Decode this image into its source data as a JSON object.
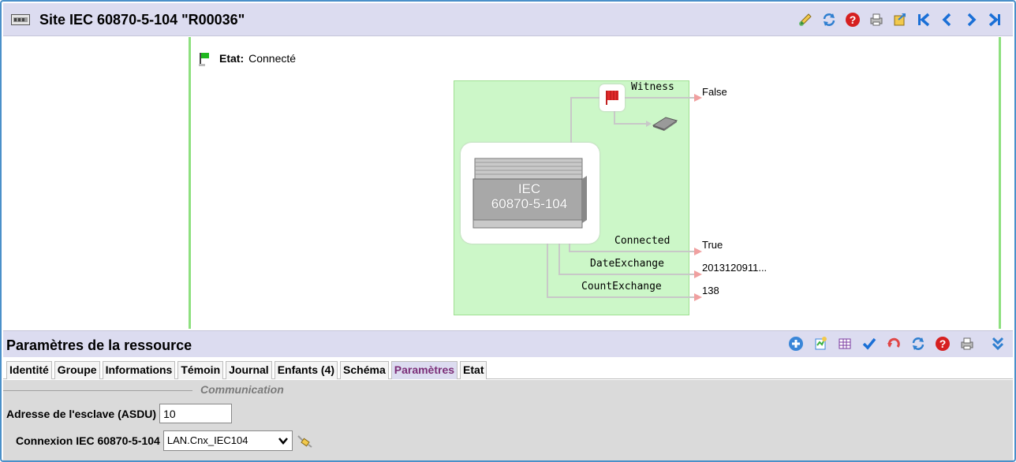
{
  "header": {
    "title": "Site IEC 60870-5-104 \"R00036\"",
    "icons": [
      "edit-icon",
      "refresh-icon",
      "help-icon",
      "print-icon",
      "export-icon",
      "first-icon",
      "previous-icon",
      "next-icon",
      "last-icon"
    ]
  },
  "diagram": {
    "etat_label": "Etat:",
    "etat_value": "Connecté",
    "device_label_line1": "IEC",
    "device_label_line2": "60870-5-104",
    "outputs": [
      {
        "name": "Witness",
        "value": "False"
      },
      {
        "name": "Connected",
        "value": "True"
      },
      {
        "name": "DateExchange",
        "value": "2013120911..."
      },
      {
        "name": "CountExchange",
        "value": "138"
      }
    ],
    "colors": {
      "state_box": "#ccf7c8",
      "rail": "#8ee07f",
      "arrow": "#f0a0a0"
    }
  },
  "params": {
    "title": "Paramètres de la ressource",
    "icons": [
      "add-icon",
      "new-icon",
      "grid-icon",
      "validate-icon",
      "undo-icon",
      "refresh-icon",
      "help-icon",
      "print-icon",
      "collapse-icon"
    ],
    "tabs": [
      "Identité",
      "Groupe",
      "Informations",
      "Témoin",
      "Journal",
      "Enfants (4)",
      "Schéma",
      "Paramètres",
      "Etat"
    ],
    "active_tab": "Paramètres",
    "section": "Communication",
    "fields": {
      "asdu_label": "Adresse de l'esclave (ASDU)",
      "asdu_value": "10",
      "conn_label": "Connexion IEC 60870-5-104",
      "conn_value": "LAN.Cnx_IEC104"
    }
  }
}
